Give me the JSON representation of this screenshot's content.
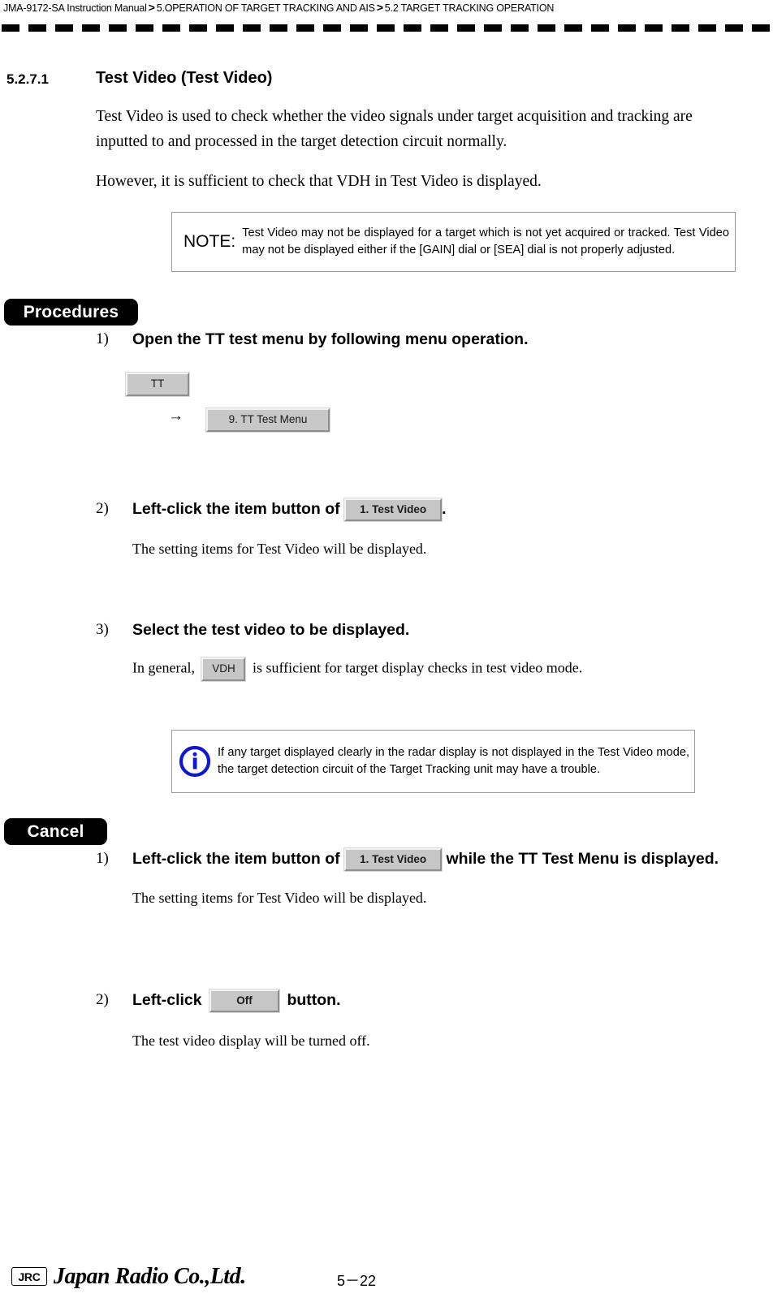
{
  "header": {
    "manual": "JMA-9172-SA Instruction Manual",
    "sep": ">",
    "chapter": "5.OPERATION OF TARGET TRACKING AND AIS",
    "section": "5.2  TARGET TRACKING OPERATION"
  },
  "section": {
    "number": "5.2.7.1",
    "title": "Test Video (Test Video)",
    "intro": "Test Video is used to check whether the video signals under target acquisition and tracking are inputted to and processed in the target detection circuit normally.",
    "however": "However, it is sufficient to check that VDH in Test Video is displayed."
  },
  "note": {
    "label": "NOTE:",
    "text": "Test Video may not be displayed for a target which is not yet acquired or tracked. Test Video may not be displayed either if the [GAIN] dial or [SEA] dial is not properly adjusted."
  },
  "procedures": {
    "badge": "Procedures",
    "steps": [
      {
        "num": "1)",
        "head": "Open the TT test menu by following menu operation.",
        "chip_tt": "TT",
        "arrow": "→",
        "chip_menu": "9. TT Test Menu"
      },
      {
        "num": "2)",
        "head_before": "Left-click the item button of",
        "chip": "1. Test Video",
        "head_after": ".",
        "body": "The setting items for Test Video will be displayed."
      },
      {
        "num": "3)",
        "head": "Select the test video to be displayed.",
        "body_before": "In general,",
        "chip": "VDH",
        "body_after": "is sufficient for target display checks in test video mode."
      }
    ]
  },
  "info": {
    "icon": "info-circle-icon",
    "text": "If any target displayed clearly in the radar display is not displayed in the Test Video mode, the target detection circuit of the Target Tracking unit may have a trouble.",
    "color": "#1018c8"
  },
  "cancel": {
    "badge": "Cancel",
    "steps": [
      {
        "num": "1)",
        "head_before": "Left-click the item button of",
        "chip": "1. Test Video",
        "head_after": "while the TT Test Menu is displayed.",
        "body": "The setting items for Test Video will be displayed."
      },
      {
        "num": "2)",
        "head_before": "Left-click",
        "chip": "Off",
        "head_after": "button.",
        "body": "The test video display will be turned off."
      }
    ]
  },
  "footer": {
    "logo": "JRC",
    "company": "Japan Radio Co.,Ltd.",
    "page": "5－22"
  }
}
